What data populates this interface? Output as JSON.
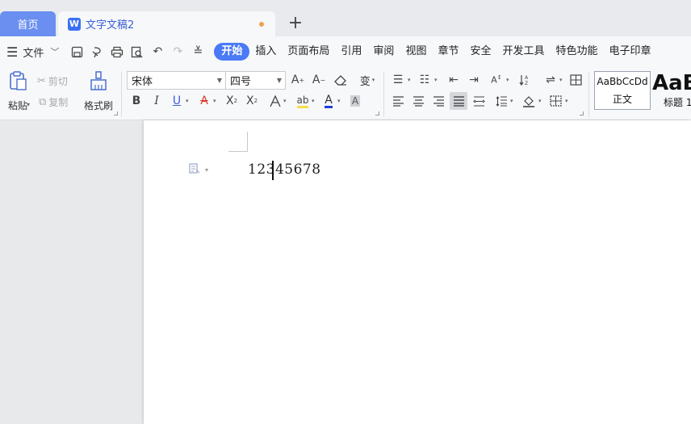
{
  "tabs": {
    "home_label": "首页",
    "doc_label": "文字文稿2",
    "doc_icon": "W",
    "add_symbol": "+"
  },
  "menu": {
    "file_label": "文件",
    "tabs": [
      "开始",
      "插入",
      "页面布局",
      "引用",
      "审阅",
      "视图",
      "章节",
      "安全",
      "开发工具",
      "特色功能",
      "电子印章"
    ],
    "active_tab": "开始"
  },
  "ribbon": {
    "paste_label": "粘贴",
    "cut_label": "剪切",
    "copy_label": "复制",
    "format_painter_label": "格式刷",
    "font_name": "宋体",
    "font_size": "四号",
    "bold": "B",
    "italic": "I",
    "underline": "U",
    "styles": [
      {
        "sample": "AaBbCcDd",
        "name": "正文"
      },
      {
        "sample": "AaB",
        "name": "标题 1"
      }
    ]
  },
  "document": {
    "text": "12345678",
    "cursor_after_chars": 3
  },
  "colors": {
    "accent": "#4a7af5",
    "home_tab": "#6a8ff0",
    "modified_dot": "#f0a050",
    "font_color_underline": "#1f3fd8",
    "highlight_red": "#d9382c"
  }
}
